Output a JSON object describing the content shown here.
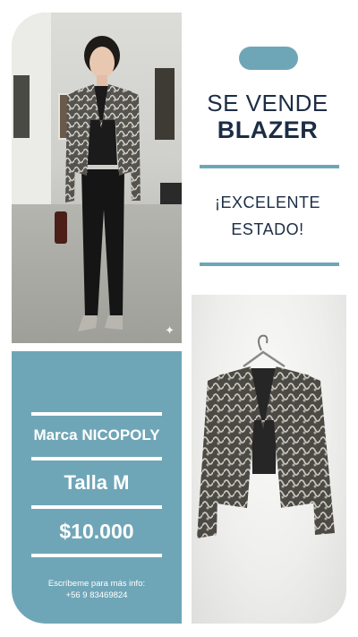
{
  "header": {
    "line1": "SE VENDE",
    "line2": "BLAZER",
    "subline1": "¡EXCELENTE",
    "subline2": "ESTADO!"
  },
  "info": {
    "brand": "Marca NICOPOLY",
    "size": "Talla M",
    "price": "$10.000",
    "contact_label": "Escríbeme para más info:",
    "phone": "+56 9 83469824"
  },
  "colors": {
    "accent": "#6fa6b7",
    "heading": "#1c2d45",
    "background": "#ffffff"
  },
  "icons": {
    "photo_corner": "sparkle-icon"
  }
}
